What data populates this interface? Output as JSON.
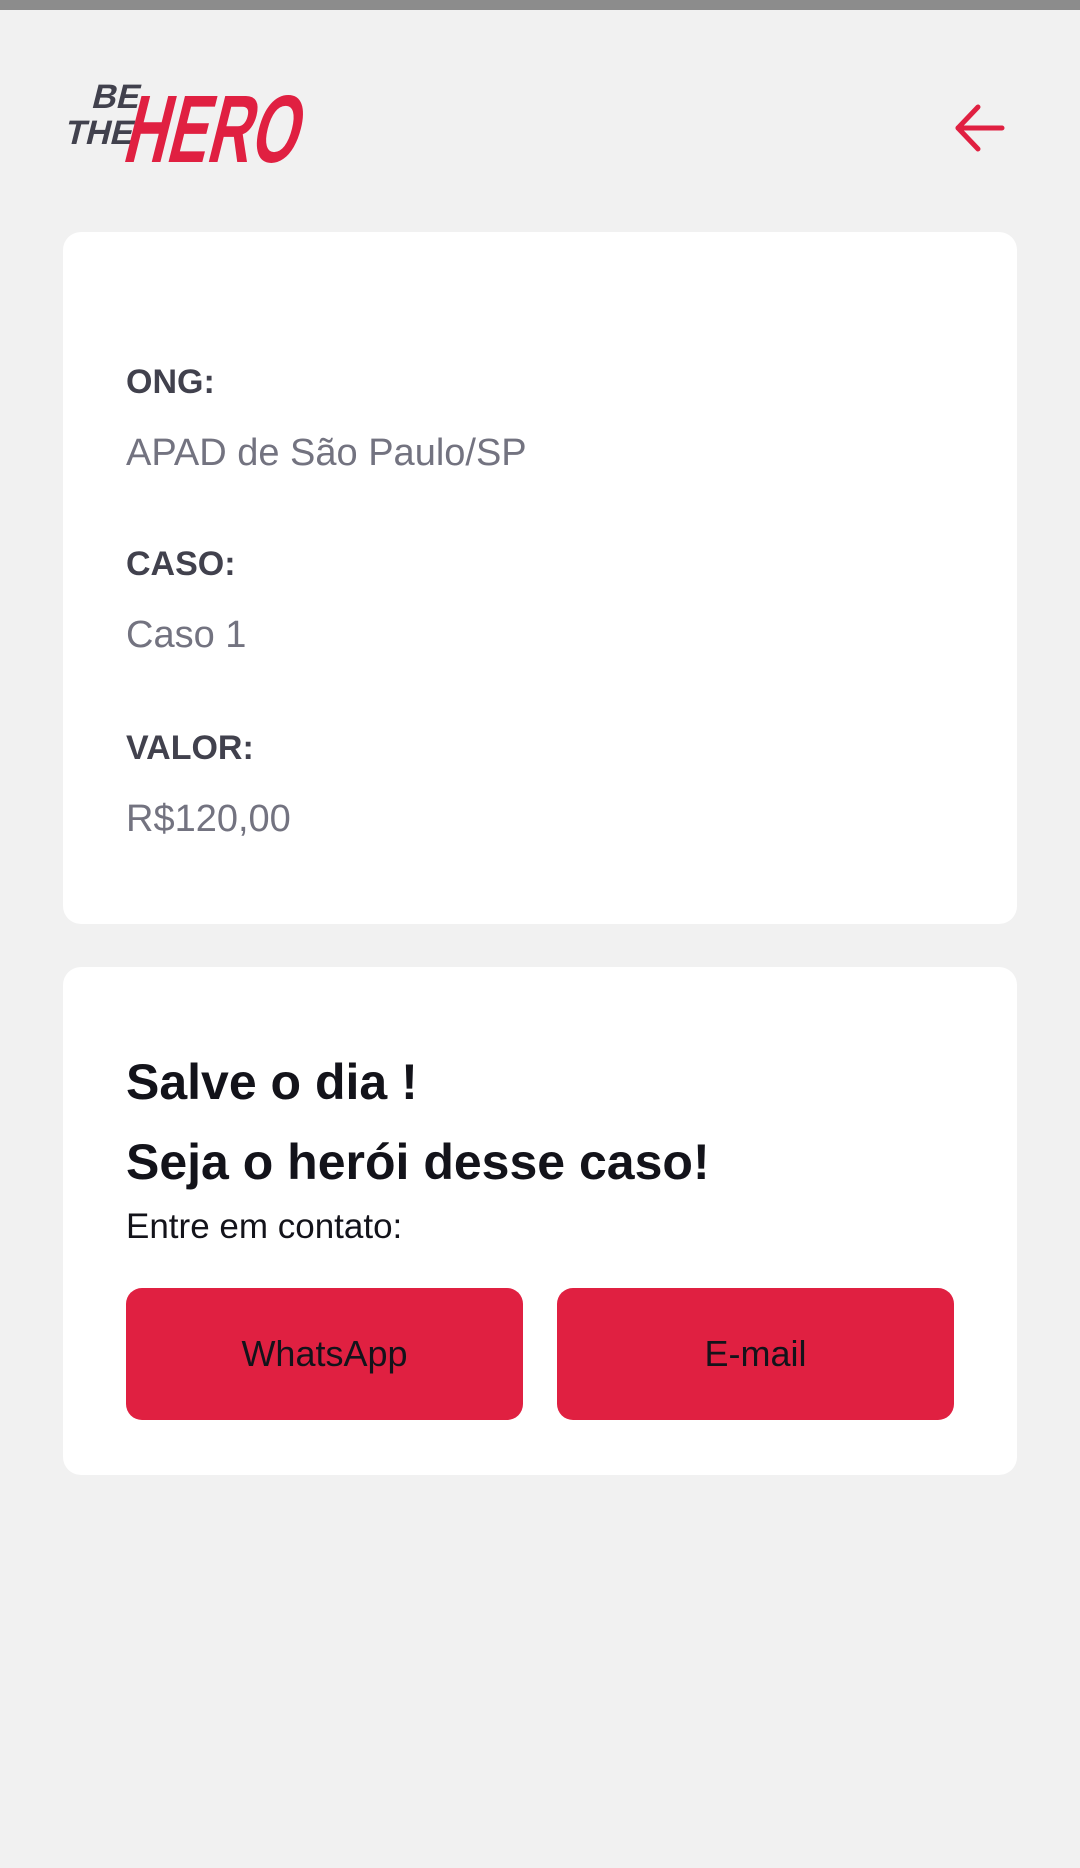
{
  "app": {
    "logo_text_small_1": "BE",
    "logo_text_small_2": "THE",
    "logo_text_large": "HERO"
  },
  "header": {
    "back_icon": "arrow-left-icon"
  },
  "incident": {
    "ong_label": "ONG:",
    "ong_value": "APAD de São Paulo/SP",
    "case_label": "CASO:",
    "case_value": "Caso 1",
    "value_label": "VALOR:",
    "value_value": "R$120,00"
  },
  "contact": {
    "title_line1": "Salve o dia !",
    "title_line2": "Seja o herói desse caso!",
    "subtitle": "Entre em contato:",
    "whatsapp_label": "WhatsApp",
    "email_label": "E-mail"
  },
  "colors": {
    "accent": "#e02041",
    "background": "#f1f1f1",
    "card": "#ffffff",
    "label": "#41414d",
    "value": "#737380",
    "text_dark": "#13131a"
  }
}
